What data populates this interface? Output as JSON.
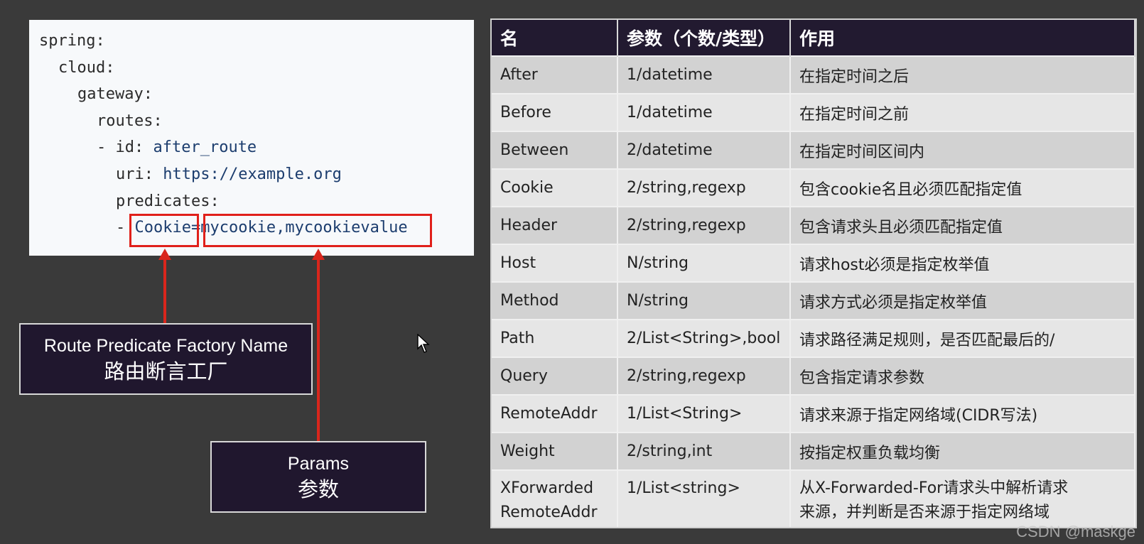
{
  "code": {
    "lines": [
      {
        "key": "spring:",
        "val": ""
      },
      {
        "key": "cloud:",
        "val": ""
      },
      {
        "key": "gateway:",
        "val": ""
      },
      {
        "key": "routes:",
        "val": ""
      },
      {
        "key": "- id: ",
        "val": "after_route"
      },
      {
        "key": "uri: ",
        "val": "https://example.org"
      },
      {
        "key": "predicates:",
        "val": ""
      },
      {
        "key": "- ",
        "val": "Cookie=mycookie,mycookievalue"
      }
    ]
  },
  "labels": {
    "factory_en": "Route Predicate Factory Name",
    "factory_zh": "路由断言工厂",
    "params_en": "Params",
    "params_zh": "参数"
  },
  "table": {
    "headers": [
      "名",
      "参数（个数/类型）",
      "作用"
    ],
    "rows": [
      [
        "After",
        "1/datetime",
        "在指定时间之后"
      ],
      [
        "Before",
        "1/datetime",
        "在指定时间之前"
      ],
      [
        "Between",
        "2/datetime",
        "在指定时间区间内"
      ],
      [
        "Cookie",
        "2/string,regexp",
        "包含cookie名且必须匹配指定值"
      ],
      [
        "Header",
        "2/string,regexp",
        "包含请求头且必须匹配指定值"
      ],
      [
        "Host",
        "N/string",
        "请求host必须是指定枚举值"
      ],
      [
        "Method",
        "N/string",
        "请求方式必须是指定枚举值"
      ],
      [
        "Path",
        "2/List<String>,bool",
        "请求路径满足规则，是否匹配最后的/"
      ],
      [
        "Query",
        "2/string,regexp",
        "包含指定请求参数"
      ],
      [
        "RemoteAddr",
        "1/List<String>",
        "请求来源于指定网络域(CIDR写法)"
      ],
      [
        "Weight",
        "2/string,int",
        "按指定权重负载均衡"
      ],
      [
        "XForwarded\nRemoteAddr",
        "1/List<string>",
        "从X-Forwarded-For请求头中解析请求\n来源，并判断是否来源于指定网络域"
      ]
    ]
  },
  "watermark": "CSDN @maskge",
  "colors": {
    "accent_red": "#e0201a",
    "label_bg": "#20172e",
    "header_bg": "#221a30"
  }
}
